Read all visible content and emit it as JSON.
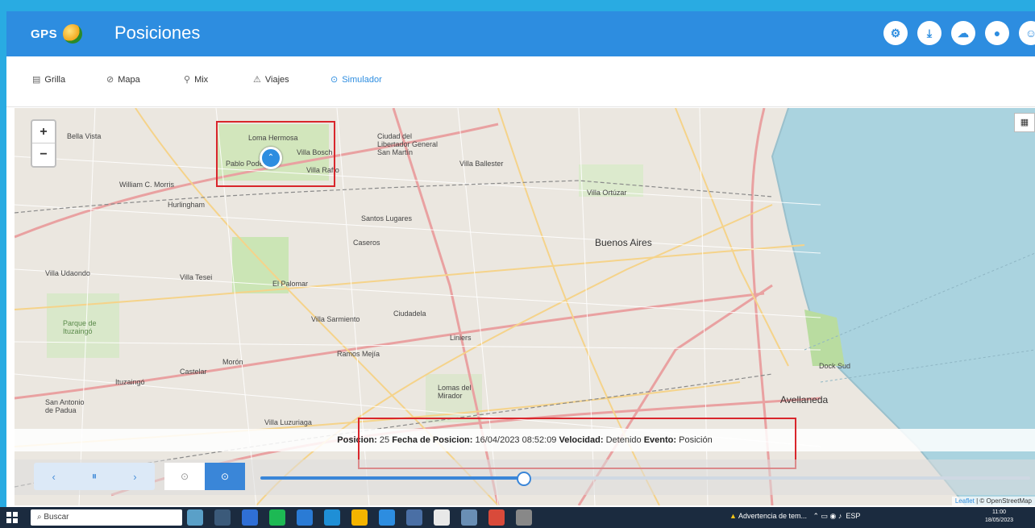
{
  "appbar": {
    "logo_text": "GPS",
    "title": "Posiciones",
    "actions": [
      "settings-icon",
      "download-icon",
      "cloud-icon",
      "globe-icon",
      "user-icon"
    ]
  },
  "tabs": [
    {
      "label": "Grilla",
      "icon": "grid-icon"
    },
    {
      "label": "Mapa",
      "icon": "map-icon"
    },
    {
      "label": "Mix",
      "icon": "mix-icon"
    },
    {
      "label": "Viajes",
      "icon": "route-icon"
    },
    {
      "label": "Simulador",
      "icon": "play-icon",
      "active": true
    }
  ],
  "map": {
    "zoom_in": "+",
    "zoom_out": "−",
    "places": [
      "Bella Vista",
      "Loma Hermosa",
      "Ciudad del Libertador General San Martín",
      "Villa Bosch",
      "Villa Ballester",
      "Pablo Podestá",
      "Villa Raffo",
      "Hurlingham",
      "William C. Morris",
      "Santos Lugares",
      "Villa Udaondo",
      "Villa Tesei",
      "El Palomar",
      "Caseros",
      "Buenos Aires",
      "Villa Sarmiento",
      "Ciudadela",
      "Ramos Mejía",
      "Ituzaingó",
      "Castelar",
      "Morón",
      "San Antonio de Padua",
      "Villa Luzuriaga",
      "Lomas del Mirador",
      "Avellaneda",
      "Dock Sud",
      "Parque de Ituzaingó",
      "Liniers",
      "Villa Ortúzar"
    ],
    "marker_icon": "location-marker-icon",
    "accent": "#2d8de0",
    "highlight": "#d9262c"
  },
  "info": {
    "posicion_label": "Posicion:",
    "posicion_value": "25",
    "fecha_label": "Fecha de Posicion:",
    "fecha_value": "16/04/2023 08:52:09",
    "velocidad_label": "Velocidad:",
    "velocidad_value": "Detenido",
    "evento_label": "Evento:",
    "evento_value": "Posición"
  },
  "player": {
    "prev": "‹",
    "pause": "⏸",
    "next": "›",
    "stop": "⊙",
    "play": "⊙",
    "progress": 0.34
  },
  "attribution": {
    "leaflet": "Leaflet",
    "osm": "© OpenStreetMap"
  },
  "taskbar": {
    "search_placeholder": "Buscar",
    "warning": "Advertencia de tem...",
    "lang": "ESP",
    "time": "11:00",
    "date": "18/05/2023"
  }
}
